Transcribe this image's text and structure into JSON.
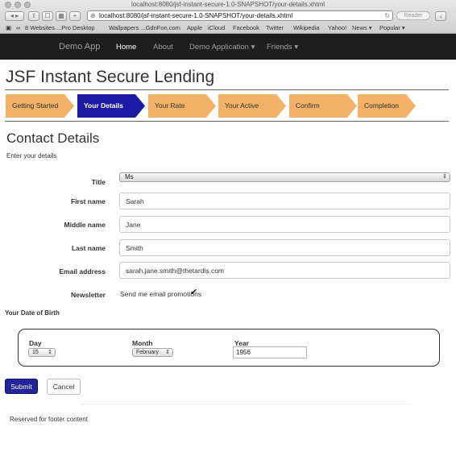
{
  "browser": {
    "window_title": "localhost:8080/jsf-instant-secure-1.0-SNAPSHOT/your-details.xhtml",
    "url": "localhost:8080/jsf-instant-secure-1.0-SNAPSHOT/your-details.xhtml",
    "reader_label": "Reader",
    "bookmarks": [
      "8 Websites ...Pro Desktop",
      "Wallpapers ...GdnFon.com",
      "Apple",
      "iCloud",
      "Facebook",
      "Twitter",
      "Wikipedia",
      "Yahoo!",
      "News ▾",
      "Popular ▾"
    ]
  },
  "navbar": {
    "brand": "Demo App",
    "items": [
      {
        "label": "Home",
        "active": true
      },
      {
        "label": "About"
      },
      {
        "label": "Demo Application ▾"
      },
      {
        "label": "Friends ▾"
      }
    ]
  },
  "page_title": "JSF Instant Secure Lending",
  "wizard": {
    "steps": [
      {
        "label": "Getting Started"
      },
      {
        "label": "Your Details",
        "active": true
      },
      {
        "label": "Your Rate"
      },
      {
        "label": "Your Active"
      },
      {
        "label": "Confirm"
      },
      {
        "label": "Completion"
      }
    ]
  },
  "form": {
    "section_title": "Contact Details",
    "intro": "Enter your details",
    "title_label": "Title",
    "title_value": "Ms",
    "first_name_label": "First name",
    "first_name_value": "Sarah",
    "middle_name_label": "Middle name",
    "middle_name_value": "Jane",
    "last_name_label": "Last name",
    "last_name_value": "Smith",
    "email_label": "Email address",
    "email_value": "sarah.jane.smith@thetardis.com",
    "newsletter_label": "Newsletter",
    "newsletter_text": "Send me email promotions",
    "newsletter_checked": true
  },
  "dob": {
    "title": "Your Date of Birth",
    "day_label": "Day",
    "day_value": "15",
    "month_label": "Month",
    "month_value": "February",
    "year_label": "Year",
    "year_value": "1956"
  },
  "actions": {
    "submit_label": "Submit",
    "cancel_label": "Cancel"
  },
  "footer": {
    "text": "Reserved for footer content"
  },
  "colors": {
    "navbar_bg": "#1e1e1e",
    "step_inactive": "#f3b067",
    "step_active": "#1a1aa6",
    "submit_bg": "#23239b"
  }
}
